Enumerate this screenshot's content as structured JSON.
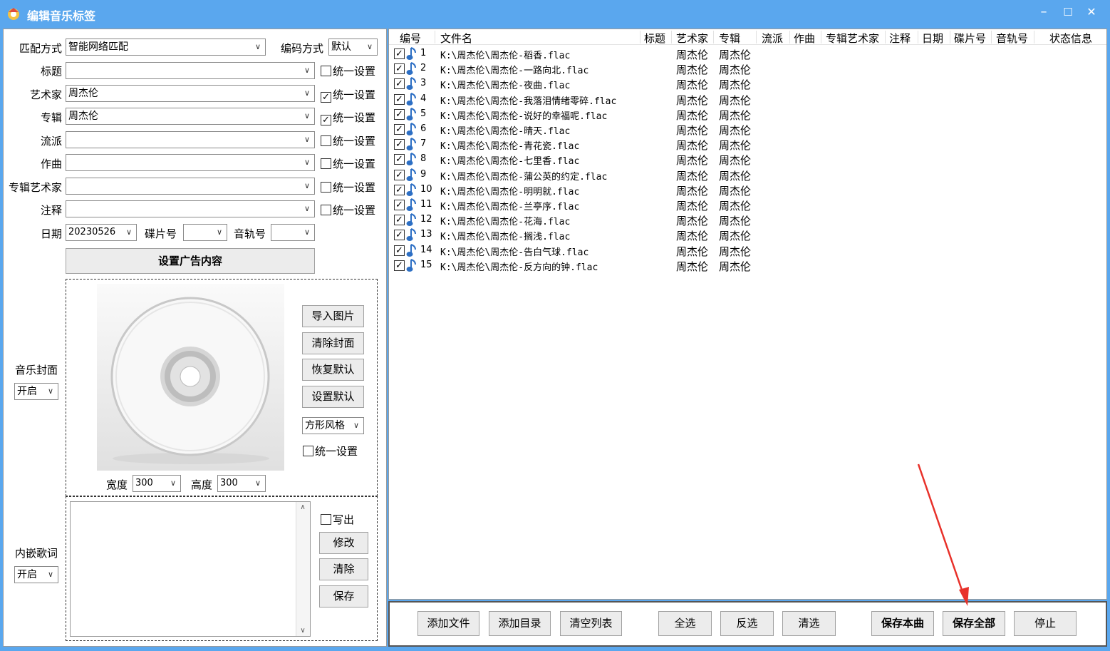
{
  "window": {
    "title": "编辑音乐标签",
    "min": "–",
    "max": "☐",
    "close": "✕"
  },
  "form": {
    "match_label": "匹配方式",
    "match_value": "智能网络匹配",
    "encoding_label": "编码方式",
    "encoding_value": "默认",
    "title_label": "标题",
    "title_value": "",
    "artist_label": "艺术家",
    "artist_value": "周杰伦",
    "album_label": "专辑",
    "album_value": "周杰伦",
    "genre_label": "流派",
    "genre_value": "",
    "composer_label": "作曲",
    "composer_value": "",
    "album_artist_label": "专辑艺术家",
    "album_artist_value": "",
    "comment_label": "注释",
    "comment_value": "",
    "unify_label": "统一设置",
    "date_label": "日期",
    "date_value": "20230526",
    "disc_label": "碟片号",
    "disc_value": "",
    "track_label": "音轨号",
    "track_value": "",
    "ad_button": "设置广告内容"
  },
  "cover": {
    "label": "音乐封面",
    "state": "开启",
    "import": "导入图片",
    "clear": "清除封面",
    "restore": "恢复默认",
    "setdefault": "设置默认",
    "style": "方形风格",
    "unify": "统一设置",
    "width_label": "宽度",
    "width_value": "300",
    "height_label": "高度",
    "height_value": "300"
  },
  "lyrics": {
    "label": "内嵌歌词",
    "state": "开启",
    "write": "写出",
    "modify": "修改",
    "clear": "清除",
    "save": "保存"
  },
  "list": {
    "headers": [
      "编号",
      "文件名",
      "标题",
      "艺术家",
      "专辑",
      "流派",
      "作曲",
      "专辑艺术家",
      "注释",
      "日期",
      "碟片号",
      "音轨号",
      "状态信息"
    ],
    "rows": [
      {
        "num": "1",
        "file": "K:\\周杰伦\\周杰伦-稻香.flac",
        "artist": "周杰伦",
        "album": "周杰伦"
      },
      {
        "num": "2",
        "file": "K:\\周杰伦\\周杰伦-一路向北.flac",
        "artist": "周杰伦",
        "album": "周杰伦"
      },
      {
        "num": "3",
        "file": "K:\\周杰伦\\周杰伦-夜曲.flac",
        "artist": "周杰伦",
        "album": "周杰伦"
      },
      {
        "num": "4",
        "file": "K:\\周杰伦\\周杰伦-我落泪情绪零碎.flac",
        "artist": "周杰伦",
        "album": "周杰伦"
      },
      {
        "num": "5",
        "file": "K:\\周杰伦\\周杰伦-说好的幸福呢.flac",
        "artist": "周杰伦",
        "album": "周杰伦"
      },
      {
        "num": "6",
        "file": "K:\\周杰伦\\周杰伦-晴天.flac",
        "artist": "周杰伦",
        "album": "周杰伦"
      },
      {
        "num": "7",
        "file": "K:\\周杰伦\\周杰伦-青花瓷.flac",
        "artist": "周杰伦",
        "album": "周杰伦"
      },
      {
        "num": "8",
        "file": "K:\\周杰伦\\周杰伦-七里香.flac",
        "artist": "周杰伦",
        "album": "周杰伦"
      },
      {
        "num": "9",
        "file": "K:\\周杰伦\\周杰伦-蒲公英的约定.flac",
        "artist": "周杰伦",
        "album": "周杰伦"
      },
      {
        "num": "10",
        "file": "K:\\周杰伦\\周杰伦-明明就.flac",
        "artist": "周杰伦",
        "album": "周杰伦"
      },
      {
        "num": "11",
        "file": "K:\\周杰伦\\周杰伦-兰亭序.flac",
        "artist": "周杰伦",
        "album": "周杰伦"
      },
      {
        "num": "12",
        "file": "K:\\周杰伦\\周杰伦-花海.flac",
        "artist": "周杰伦",
        "album": "周杰伦"
      },
      {
        "num": "13",
        "file": "K:\\周杰伦\\周杰伦-搁浅.flac",
        "artist": "周杰伦",
        "album": "周杰伦"
      },
      {
        "num": "14",
        "file": "K:\\周杰伦\\周杰伦-告白气球.flac",
        "artist": "周杰伦",
        "album": "周杰伦"
      },
      {
        "num": "15",
        "file": "K:\\周杰伦\\周杰伦-反方向的钟.flac",
        "artist": "周杰伦",
        "album": "周杰伦"
      }
    ]
  },
  "actions": {
    "add_file": "添加文件",
    "add_dir": "添加目录",
    "clear_list": "清空列表",
    "select_all": "全选",
    "invert": "反选",
    "clear_sel": "清选",
    "save_one": "保存本曲",
    "save_all": "保存全部",
    "stop": "停止"
  },
  "colors": {
    "titlebar": "#5aa7ee",
    "annotation_arrow": "#e8312a",
    "note_icon": "#2d6fc4"
  }
}
